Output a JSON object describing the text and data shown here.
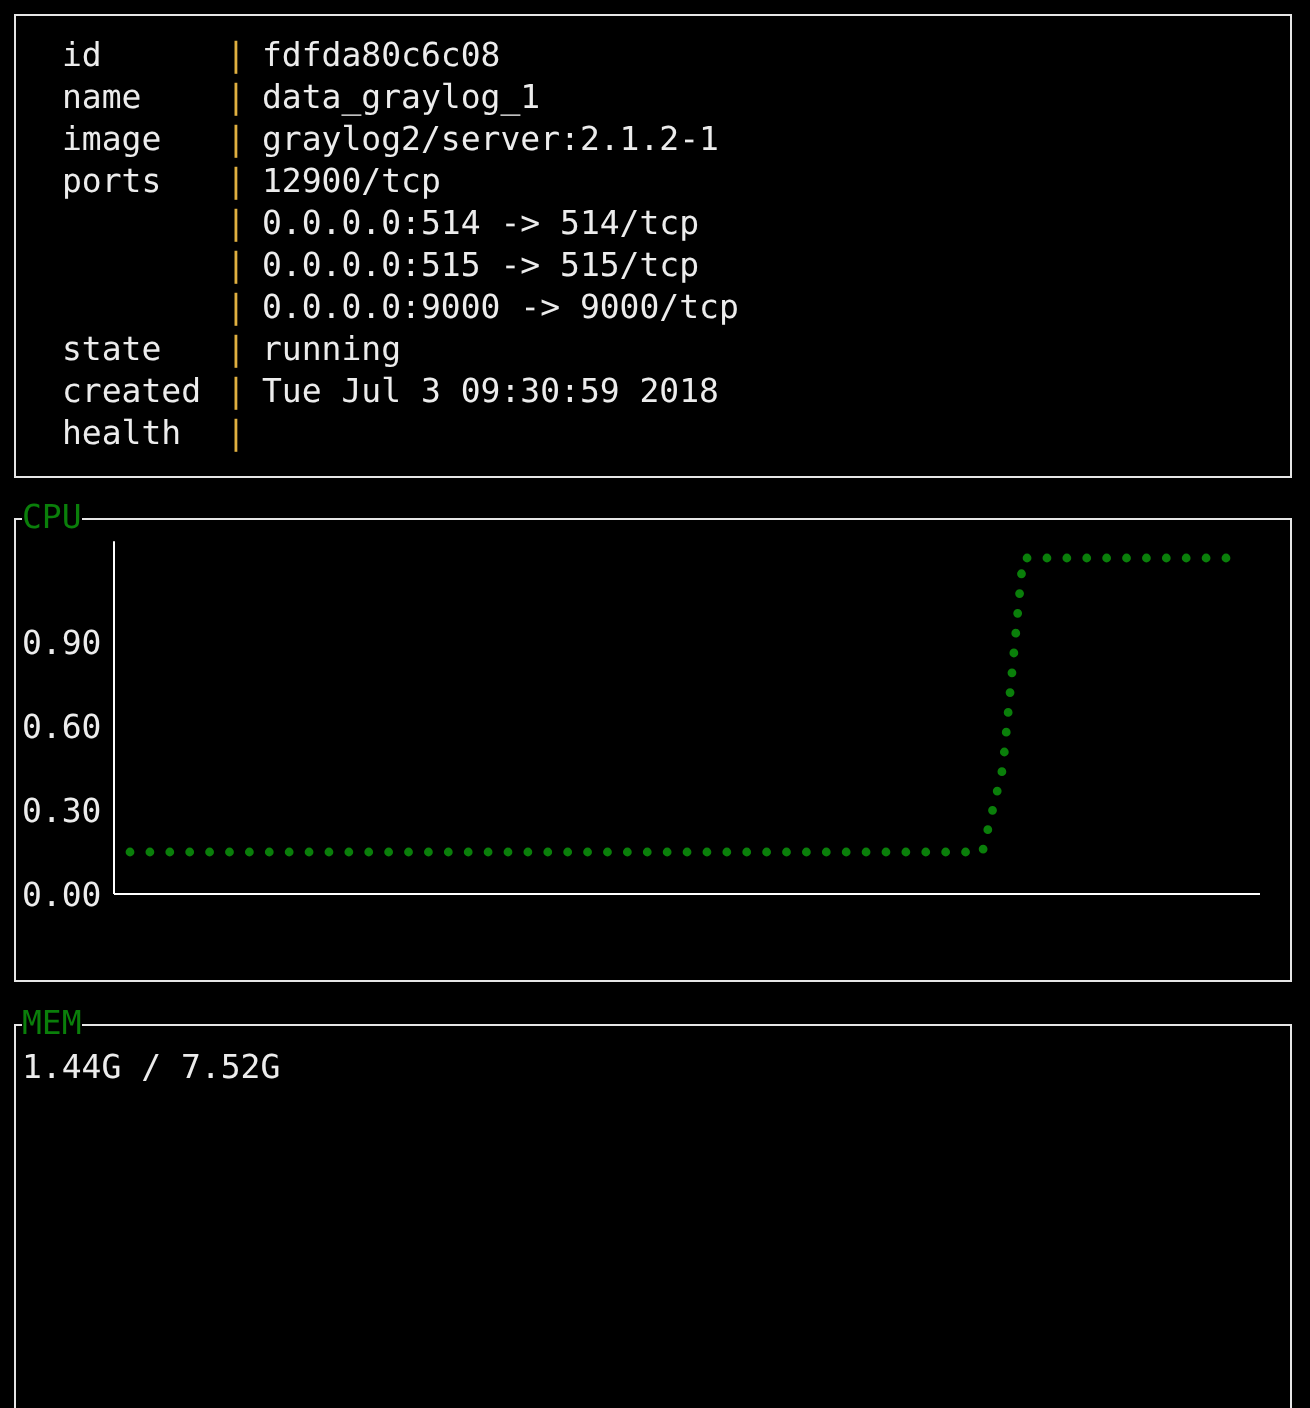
{
  "info": {
    "rows": [
      {
        "key": "id",
        "sep": "|",
        "value": "fdfda80c6c08"
      },
      {
        "key": "name",
        "sep": "|",
        "value": "data_graylog_1"
      },
      {
        "key": "image",
        "sep": "|",
        "value": "graylog2/server:2.1.2-1"
      },
      {
        "key": "ports",
        "sep": "|",
        "value": "12900/tcp"
      },
      {
        "sep": "|",
        "value": "0.0.0.0:514 -> 514/tcp"
      },
      {
        "sep": "|",
        "value": "0.0.0.0:515 -> 515/tcp"
      },
      {
        "sep": "|",
        "value": "0.0.0.0:9000 -> 9000/tcp"
      },
      {
        "key": "state",
        "sep": "|",
        "value": "running"
      },
      {
        "key": "created",
        "sep": "|",
        "value": "Tue Jul 3 09:30:59 2018"
      },
      {
        "key": "health",
        "sep": "|"
      }
    ]
  },
  "cpu": {
    "title": "CPU",
    "chart_data": {
      "type": "line",
      "ylim": [
        0,
        1.26
      ],
      "yticks": [
        {
          "value": 0,
          "label": "0.00"
        },
        {
          "value": 0.3,
          "label": "0.30"
        },
        {
          "value": 0.6,
          "label": "0.60"
        },
        {
          "value": 0.9,
          "label": "0.90"
        }
      ],
      "categories": [
        null,
        null,
        null,
        null,
        null,
        null,
        null,
        null,
        null,
        null,
        null,
        null,
        null,
        null,
        null,
        null,
        null,
        null,
        null,
        null,
        null,
        null,
        null,
        null,
        null,
        null,
        null,
        null,
        null,
        null,
        null,
        null,
        null,
        null,
        null,
        null,
        null,
        null,
        null,
        null,
        null,
        null,
        null,
        null,
        null,
        null,
        null,
        null,
        null,
        null,
        null,
        null,
        null,
        null,
        null
      ],
      "series": [
        {
          "color": "#0a7f0a",
          "line_style": "dotted",
          "values": [
            0.15,
            0.15,
            0.15,
            0.15,
            0.15,
            0.15,
            0.15,
            0.15,
            0.15,
            0.15,
            0.15,
            0.15,
            0.15,
            0.15,
            0.15,
            0.15,
            0.15,
            0.15,
            0.15,
            0.15,
            0.15,
            0.15,
            0.15,
            0.15,
            0.15,
            0.15,
            0.15,
            0.15,
            0.15,
            0.15,
            0.15,
            0.15,
            0.15,
            0.15,
            0.15,
            0.15,
            0.15,
            0.15,
            0.15,
            0.15,
            0.15,
            0.15,
            0.15,
            0.45,
            1.2,
            1.2,
            1.2,
            1.2,
            1.2,
            1.2,
            1.2,
            1.2,
            1.2,
            1.2,
            1.2
          ]
        }
      ]
    }
  },
  "mem": {
    "title": "MEM",
    "reading": "1.44G / 7.52G"
  }
}
